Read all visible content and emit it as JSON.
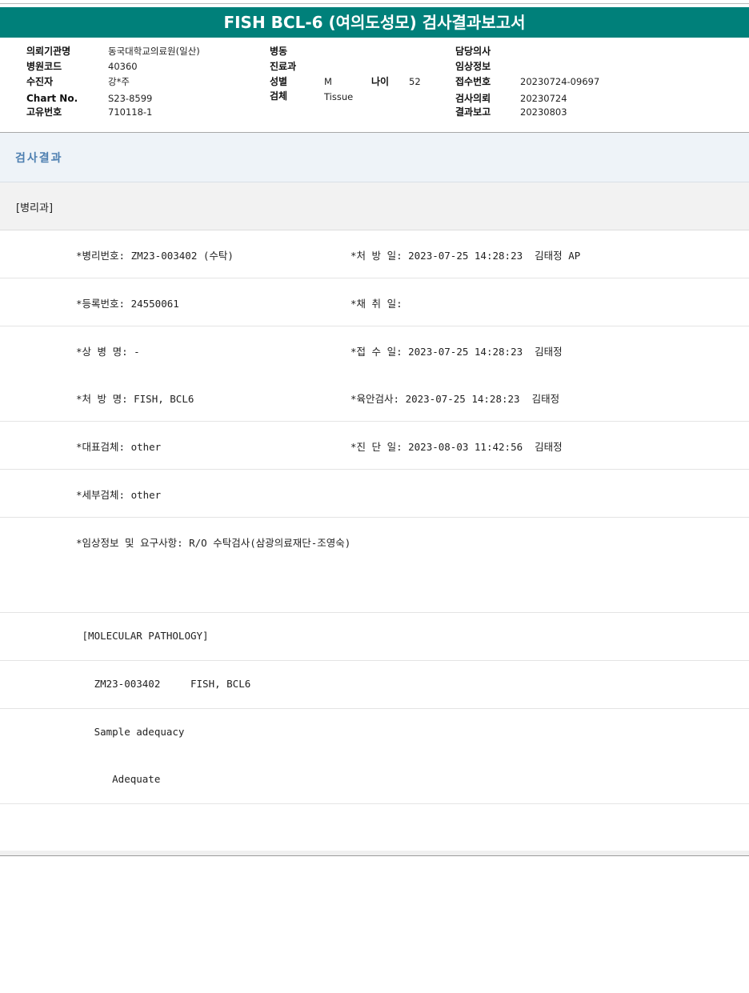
{
  "title": "FISH BCL-6 (여의도성모) 검사결과보고서",
  "info": {
    "col1": [
      {
        "label": "의뢰기관명",
        "value": "동국대학교의료원(일산)"
      },
      {
        "label": "병원코드",
        "value": "40360"
      },
      {
        "label": "수진자",
        "value": "강*주"
      },
      {
        "label": "Chart No.",
        "value": "S23-8599"
      },
      {
        "label": "고유번호",
        "value": "710118-1"
      }
    ],
    "col2": [
      {
        "label": "병동",
        "value": ""
      },
      {
        "label": "진료과",
        "value": ""
      },
      {
        "label": "성별",
        "value": "M"
      },
      {
        "label": "검체",
        "value": "Tissue"
      }
    ],
    "age_label": "나이",
    "age_value": "52",
    "col3": [
      {
        "label": "담당의사",
        "value": ""
      },
      {
        "label": "임상정보",
        "value": ""
      },
      {
        "label": "접수번호",
        "value": "20230724-09697"
      },
      {
        "label": "검사의뢰",
        "value": "20230724"
      },
      {
        "label": "결과보고",
        "value": "20230803"
      }
    ]
  },
  "section_title": "검사결과",
  "subsection": "[병리과]",
  "rows": [
    {
      "left": "*병리번호: ZM23-003402 (수탁)",
      "right": "*처 방 일: 2023-07-25 14:28:23  김태정 AP"
    },
    {
      "left": "*등록번호: 24550061",
      "right": "*채 취 일:"
    },
    {
      "left": "*상 병 명: -",
      "right": "*접 수 일: 2023-07-25 14:28:23  김태정"
    },
    {
      "left": "*처 방 명: FISH, BCL6",
      "right": "*육안검사: 2023-07-25 14:28:23  김태정"
    },
    {
      "left": "*대표검체: other",
      "right": "*진 단 일: 2023-08-03 11:42:56  김태정"
    },
    {
      "left": "*세부검체: other",
      "right": ""
    },
    {
      "left": "*임상정보 및 요구사항: R/O 수탁검사(삼광의료재단-조영숙)",
      "right": ""
    },
    {
      "left": "",
      "right": ""
    },
    {
      "left": " [MOLECULAR PATHOLOGY]",
      "right": ""
    },
    {
      "left": "   ZM23-003402     FISH, BCL6",
      "right": ""
    },
    {
      "left": "   Sample adequacy",
      "right": ""
    },
    {
      "left": "      Adequate",
      "right": ""
    },
    {
      "left": "",
      "right": ""
    }
  ]
}
